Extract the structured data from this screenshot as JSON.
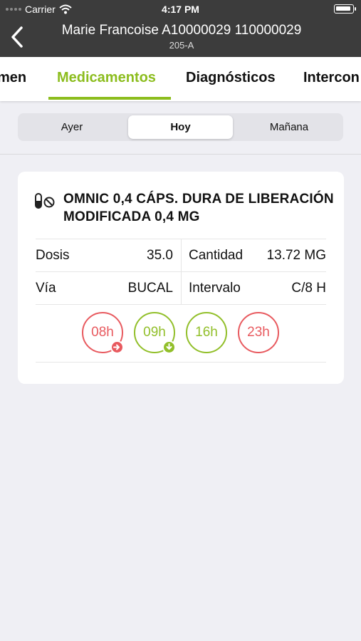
{
  "status_bar": {
    "carrier": "Carrier",
    "time": "4:17 PM"
  },
  "nav": {
    "title": "Marie Francoise A10000029 110000029",
    "subtitle": "205-A"
  },
  "tabs": [
    {
      "label": "Resumen",
      "visible_text": "men"
    },
    {
      "label": "Medicamentos",
      "active": true
    },
    {
      "label": "Diagnósticos"
    },
    {
      "label": "Interconsultas",
      "visible_text": "Intercon"
    }
  ],
  "day_segment": {
    "options": [
      "Ayer",
      "Hoy",
      "Mañana"
    ],
    "selected": "Hoy"
  },
  "medication": {
    "name": "OMNIC 0,4 CÁPS. DURA DE LIBERACIÓN MODIFICADA 0,4 MG",
    "dose_label": "Dosis",
    "dose_value": "35.0",
    "quantity_label": "Cantidad",
    "quantity_value": "13.72 MG",
    "route_label": "Vía",
    "route_value": "BUCAL",
    "interval_label": "Intervalo",
    "interval_value": "C/8 H",
    "doses": [
      {
        "time": "08h",
        "status": "missed",
        "color": "#e85a5f",
        "badge": "arrow-right-icon"
      },
      {
        "time": "09h",
        "status": "administered",
        "color": "#92bf2a",
        "badge": "arrow-down-icon"
      },
      {
        "time": "16h",
        "status": "pending",
        "color": "#92bf2a"
      },
      {
        "time": "23h",
        "status": "pending",
        "color": "#e85a5f"
      }
    ]
  },
  "colors": {
    "nav_bg": "#3c3c3c",
    "accent": "#8cbd1e",
    "alert": "#e85a5f",
    "background": "#efeff4"
  }
}
